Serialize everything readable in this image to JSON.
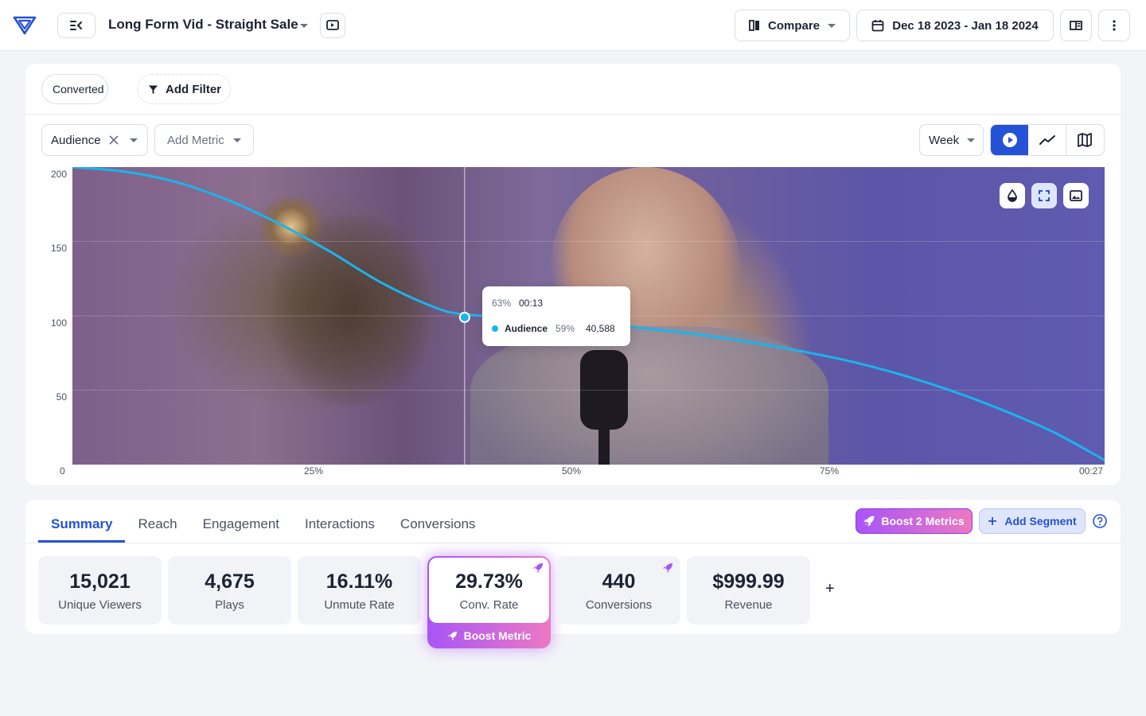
{
  "header": {
    "title": "Long Form Vid - Straight Sale",
    "compare_label": "Compare",
    "date_range": "Dec 18 2023 - Jan 18 2024"
  },
  "filters": {
    "chips": [
      "Converted"
    ],
    "add_filter_label": "Add Filter"
  },
  "metric_controls": {
    "selected_metric": "Audience",
    "add_metric_label": "Add Metric",
    "interval": "Week"
  },
  "chart_data": {
    "type": "line",
    "series": [
      {
        "name": "Audience",
        "x": [
          0,
          0.05,
          0.1,
          0.15,
          0.2,
          0.25,
          0.3,
          0.35,
          0.38,
          0.45,
          0.5,
          0.55,
          0.6,
          0.65,
          0.7,
          0.75,
          0.8,
          0.85,
          0.9,
          0.95,
          1.0
        ],
        "values": [
          200,
          197,
          190,
          178,
          162,
          143,
          122,
          106,
          101,
          98,
          96,
          92,
          88,
          83,
          77,
          70,
          61,
          50,
          37,
          22,
          3
        ],
        "color": "#1ab4ee"
      }
    ],
    "ylim": [
      0,
      200
    ],
    "yticks": [
      "200",
      "150",
      "100",
      "50",
      "0"
    ],
    "xticks": [
      "25%",
      "50%",
      "75%",
      "00:27"
    ],
    "grid": true
  },
  "tooltip": {
    "percent": "63%",
    "time": "00:13",
    "series_name": "Audience",
    "series_percent": "59%",
    "series_value": "40,588",
    "cursor_x": 0.38,
    "cursor_y": 99
  },
  "tabs": [
    "Summary",
    "Reach",
    "Engagement",
    "Interactions",
    "Conversions"
  ],
  "active_tab": "Summary",
  "actions": {
    "boost_metrics": "Boost 2 Metrics",
    "add_segment": "Add Segment"
  },
  "metrics": [
    {
      "value": "15,021",
      "label": "Unique Viewers"
    },
    {
      "value": "4,675",
      "label": "Plays"
    },
    {
      "value": "16.11%",
      "label": "Unmute Rate"
    },
    {
      "value": "29.73%",
      "label": "Conv. Rate"
    },
    {
      "value": "440",
      "label": "Conversions"
    },
    {
      "value": "$999.99",
      "label": "Revenue"
    }
  ],
  "boost_metric_label": "Boost Metric",
  "add_metric_plus": "+",
  "colors": {
    "accent": "#2452d6",
    "line": "#1ab4ee",
    "boost_gradient": [
      "#a855f7",
      "#ec4899"
    ]
  }
}
